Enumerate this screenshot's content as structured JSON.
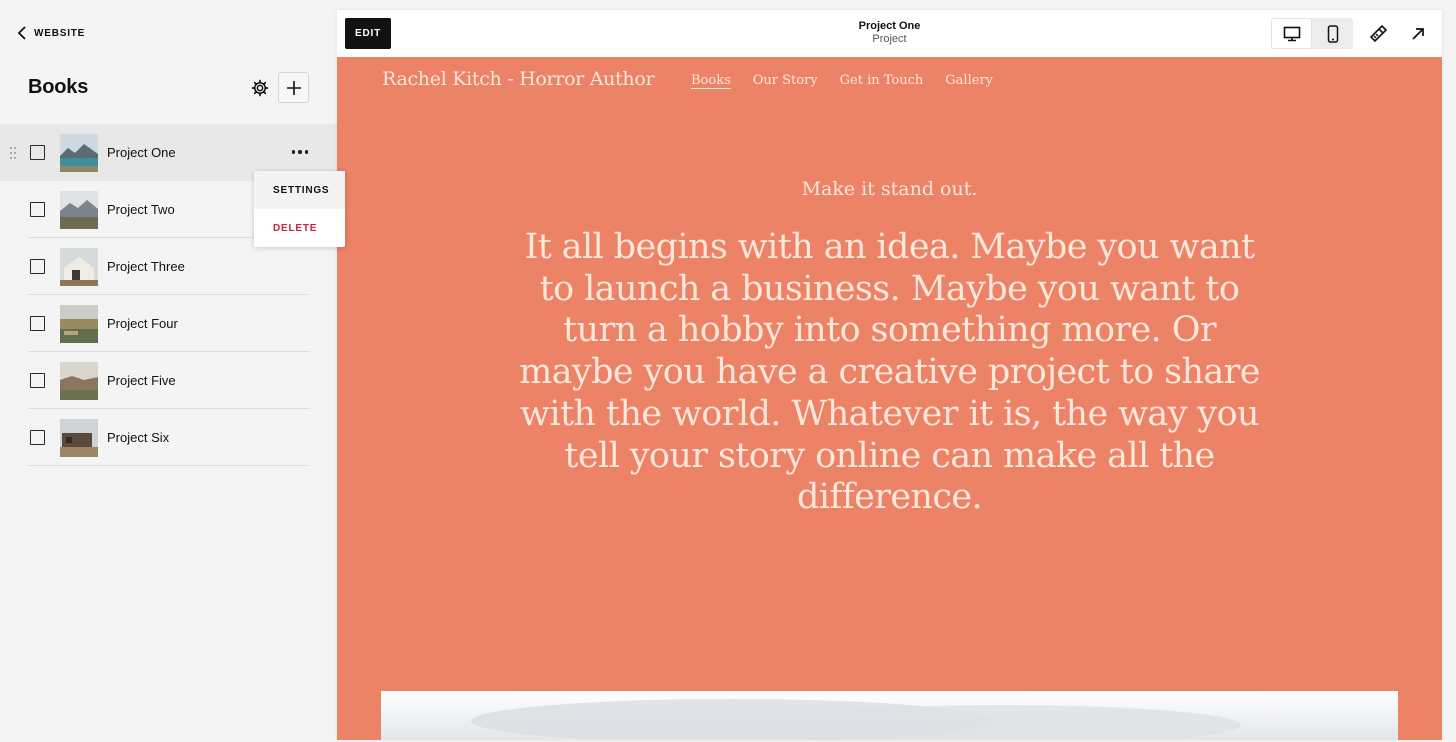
{
  "sidebar": {
    "back_label": "WEBSITE",
    "title": "Books",
    "items": [
      {
        "label": "Project One",
        "selected": true
      },
      {
        "label": "Project Two",
        "selected": false
      },
      {
        "label": "Project Three",
        "selected": false
      },
      {
        "label": "Project Four",
        "selected": false
      },
      {
        "label": "Project Five",
        "selected": false
      },
      {
        "label": "Project Six",
        "selected": false
      }
    ],
    "context_menu": {
      "settings_label": "SETTINGS",
      "delete_label": "DELETE"
    }
  },
  "toolbar": {
    "edit_label": "EDIT",
    "page_name": "Project One",
    "page_type": "Project",
    "icons": [
      "desktop-icon",
      "mobile-icon",
      "design-brush-icon",
      "open-external-icon"
    ]
  },
  "site": {
    "title": "Rachel Kitch - Horror Author",
    "nav": [
      "Books",
      "Our Story",
      "Get in Touch",
      "Gallery"
    ],
    "active_nav": "Books",
    "tagline": "Make it stand out.",
    "hero_text": "It all begins with an idea. Maybe you want to launch a business. Maybe you want to turn a hobby into something more. Or maybe you have a creative project to share with the world. Whatever it is, the way you tell your story online can make all the difference."
  },
  "colors": {
    "site_background": "#ec8266",
    "site_text": "#fde6da",
    "delete": "#c8253a",
    "edit_button": "#111111"
  }
}
